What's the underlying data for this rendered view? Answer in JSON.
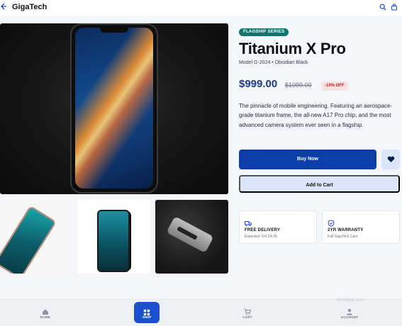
{
  "header": {
    "brand": "GigaTech"
  },
  "product": {
    "badge": "FLAGSHIP SERIES",
    "title": "Titanium X Pro",
    "meta": "Model G-2024 • Obsidian Black",
    "price": "$999.00",
    "old_price": "$1099.00",
    "discount": "-10% OFF",
    "description": "The pinnacle of mobile engineering. Featuring an aerospace-grade titanium frame, the all-new A17 Pro chip, and the most advanced camera system ever seen in a flagship."
  },
  "actions": {
    "buy_label": "Buy Now",
    "cart_label": "Add to Cart"
  },
  "features": [
    {
      "icon": "truck-icon",
      "title": "FREE DELIVERY",
      "subtitle": "Expected: Oct 24-26"
    },
    {
      "icon": "shield-check-icon",
      "title": "2YR WARRANTY",
      "subtitle": "Full GigaTech Care"
    }
  ],
  "nav": {
    "items": [
      {
        "icon": "home-icon",
        "label": "HOME"
      },
      {
        "icon": "grid-icon",
        "label": "SHOP"
      },
      {
        "icon": "cart-icon",
        "label": "CART"
      },
      {
        "icon": "user-icon",
        "label": "ACCOUNT"
      }
    ]
  },
  "watermark": {
    "brand": "mostaql.com"
  },
  "colors": {
    "accent": "#0b3ea8",
    "badge": "#0f766e",
    "price": "#1e3a8a",
    "discount_bg": "#fde2e2"
  }
}
